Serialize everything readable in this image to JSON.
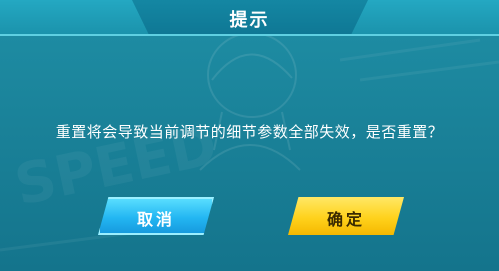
{
  "dialog": {
    "title": "提示",
    "message": "重置将会导致当前调节的细节参数全部失效，是否重置？"
  },
  "buttons": {
    "cancel_label": "取消",
    "confirm_label": "确定"
  },
  "colors": {
    "background": "#1a8299",
    "title_bar": "#24a8c2",
    "cancel_button": "#23b6f2",
    "confirm_button": "#ffd21c"
  }
}
